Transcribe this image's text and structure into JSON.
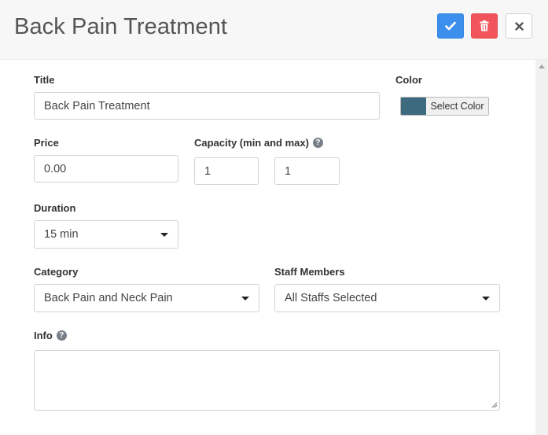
{
  "header": {
    "title": "Back Pain Treatment",
    "save_icon": "check-icon",
    "delete_icon": "trash-icon",
    "close_icon": "close-icon"
  },
  "form": {
    "title": {
      "label": "Title",
      "value": "Back Pain Treatment"
    },
    "color": {
      "label": "Color",
      "button_label": "Select Color",
      "value": "#3e6a80"
    },
    "price": {
      "label": "Price",
      "value": "0.00"
    },
    "capacity": {
      "label": "Capacity (min and max)",
      "min": "1",
      "max": "1",
      "help_icon": "question-icon"
    },
    "duration": {
      "label": "Duration",
      "value": "15 min"
    },
    "category": {
      "label": "Category",
      "value": "Back Pain and Neck Pain"
    },
    "staff": {
      "label": "Staff Members",
      "value": "All Staffs Selected"
    },
    "info": {
      "label": "Info",
      "value": "",
      "help_icon": "question-icon"
    }
  },
  "colors": {
    "save": "#3d8fee",
    "delete": "#f2545b",
    "swatch": "#3e6a80"
  }
}
